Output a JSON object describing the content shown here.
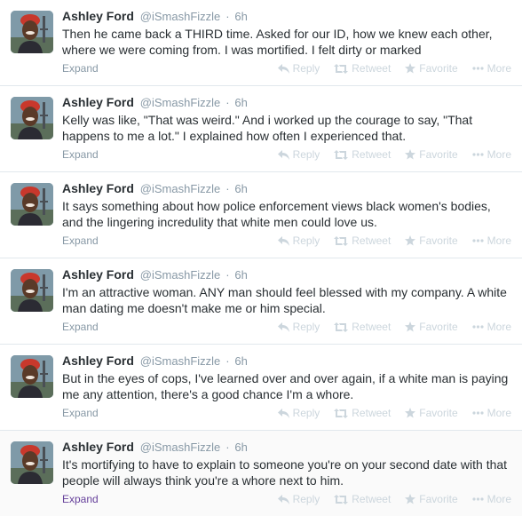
{
  "user": {
    "fullname": "Ashley Ford",
    "username": "@iSmashFizzle",
    "time": "6h"
  },
  "labels": {
    "expand": "Expand",
    "reply": "Reply",
    "retweet": "Retweet",
    "favorite": "Favorite",
    "more": "More"
  },
  "tweets": [
    {
      "text": "Then he came back a THIRD time. Asked for our ID, how we knew each other, where we were coming from. I was mortified. I felt dirty or marked"
    },
    {
      "text": "Kelly was like, \"That was weird.\" And i worked up the courage to say, \"That happens to me a lot.\" I explained how often I experienced that."
    },
    {
      "text": "It says something about how police enforcement views black women's bodies, and the lingering incredulity that white men could love us."
    },
    {
      "text": "I'm an attractive woman. ANY man should feel blessed with my company. A white man dating me doesn't make me or him special."
    },
    {
      "text": "But in the eyes of cops, I've learned over and over again, if a white man is paying me any attention, there's a good chance I'm a whore."
    },
    {
      "text": "It's mortifying to have to explain to someone you're on your second date with that people will always think you're a whore next to him."
    }
  ],
  "colors": {
    "link_hover": "#66419b",
    "muted": "#8899a6",
    "action_muted": "#ccd6dd",
    "divider": "#e1e8ed"
  },
  "icons": [
    "reply-icon",
    "retweet-icon",
    "favorite-icon",
    "more-icon"
  ]
}
